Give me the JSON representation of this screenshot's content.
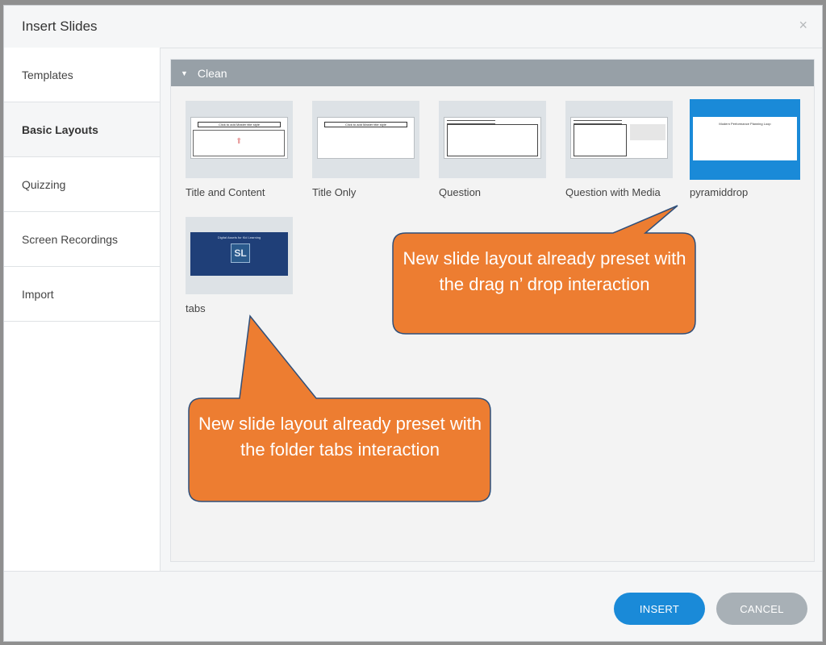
{
  "dialog": {
    "title": "Insert Slides",
    "close_glyph": "×"
  },
  "sidebar": {
    "items": [
      "Templates",
      "Basic Layouts",
      "Quizzing",
      "Screen Recordings",
      "Import"
    ],
    "active": "Basic Layouts"
  },
  "group": {
    "label": "Clean",
    "expanded": true
  },
  "thumbnails": [
    {
      "label": "Title and Content",
      "title_text": "Click to add Master title style"
    },
    {
      "label": "Title Only",
      "title_text": "Click to add Master title style"
    },
    {
      "label": "Question"
    },
    {
      "label": "Question with Media"
    },
    {
      "label": "pyramiddrop",
      "selected": true,
      "slide_text": "Modern Performance Planning Loop"
    },
    {
      "label": "tabs",
      "slide_text": "Digital Assets for Kid Learning",
      "logo_text": "SL"
    }
  ],
  "callouts": [
    {
      "text": "New slide layout already preset with the drag n’ drop interaction"
    },
    {
      "text": "New slide layout already preset with the folder tabs interaction"
    }
  ],
  "footer": {
    "insert_label": "INSERT",
    "cancel_label": "CANCEL"
  },
  "colors": {
    "accent": "#1a8ad8",
    "callout": "#ed7d31",
    "callout_border": "#2f4f7a",
    "header": "#97a0a7"
  }
}
